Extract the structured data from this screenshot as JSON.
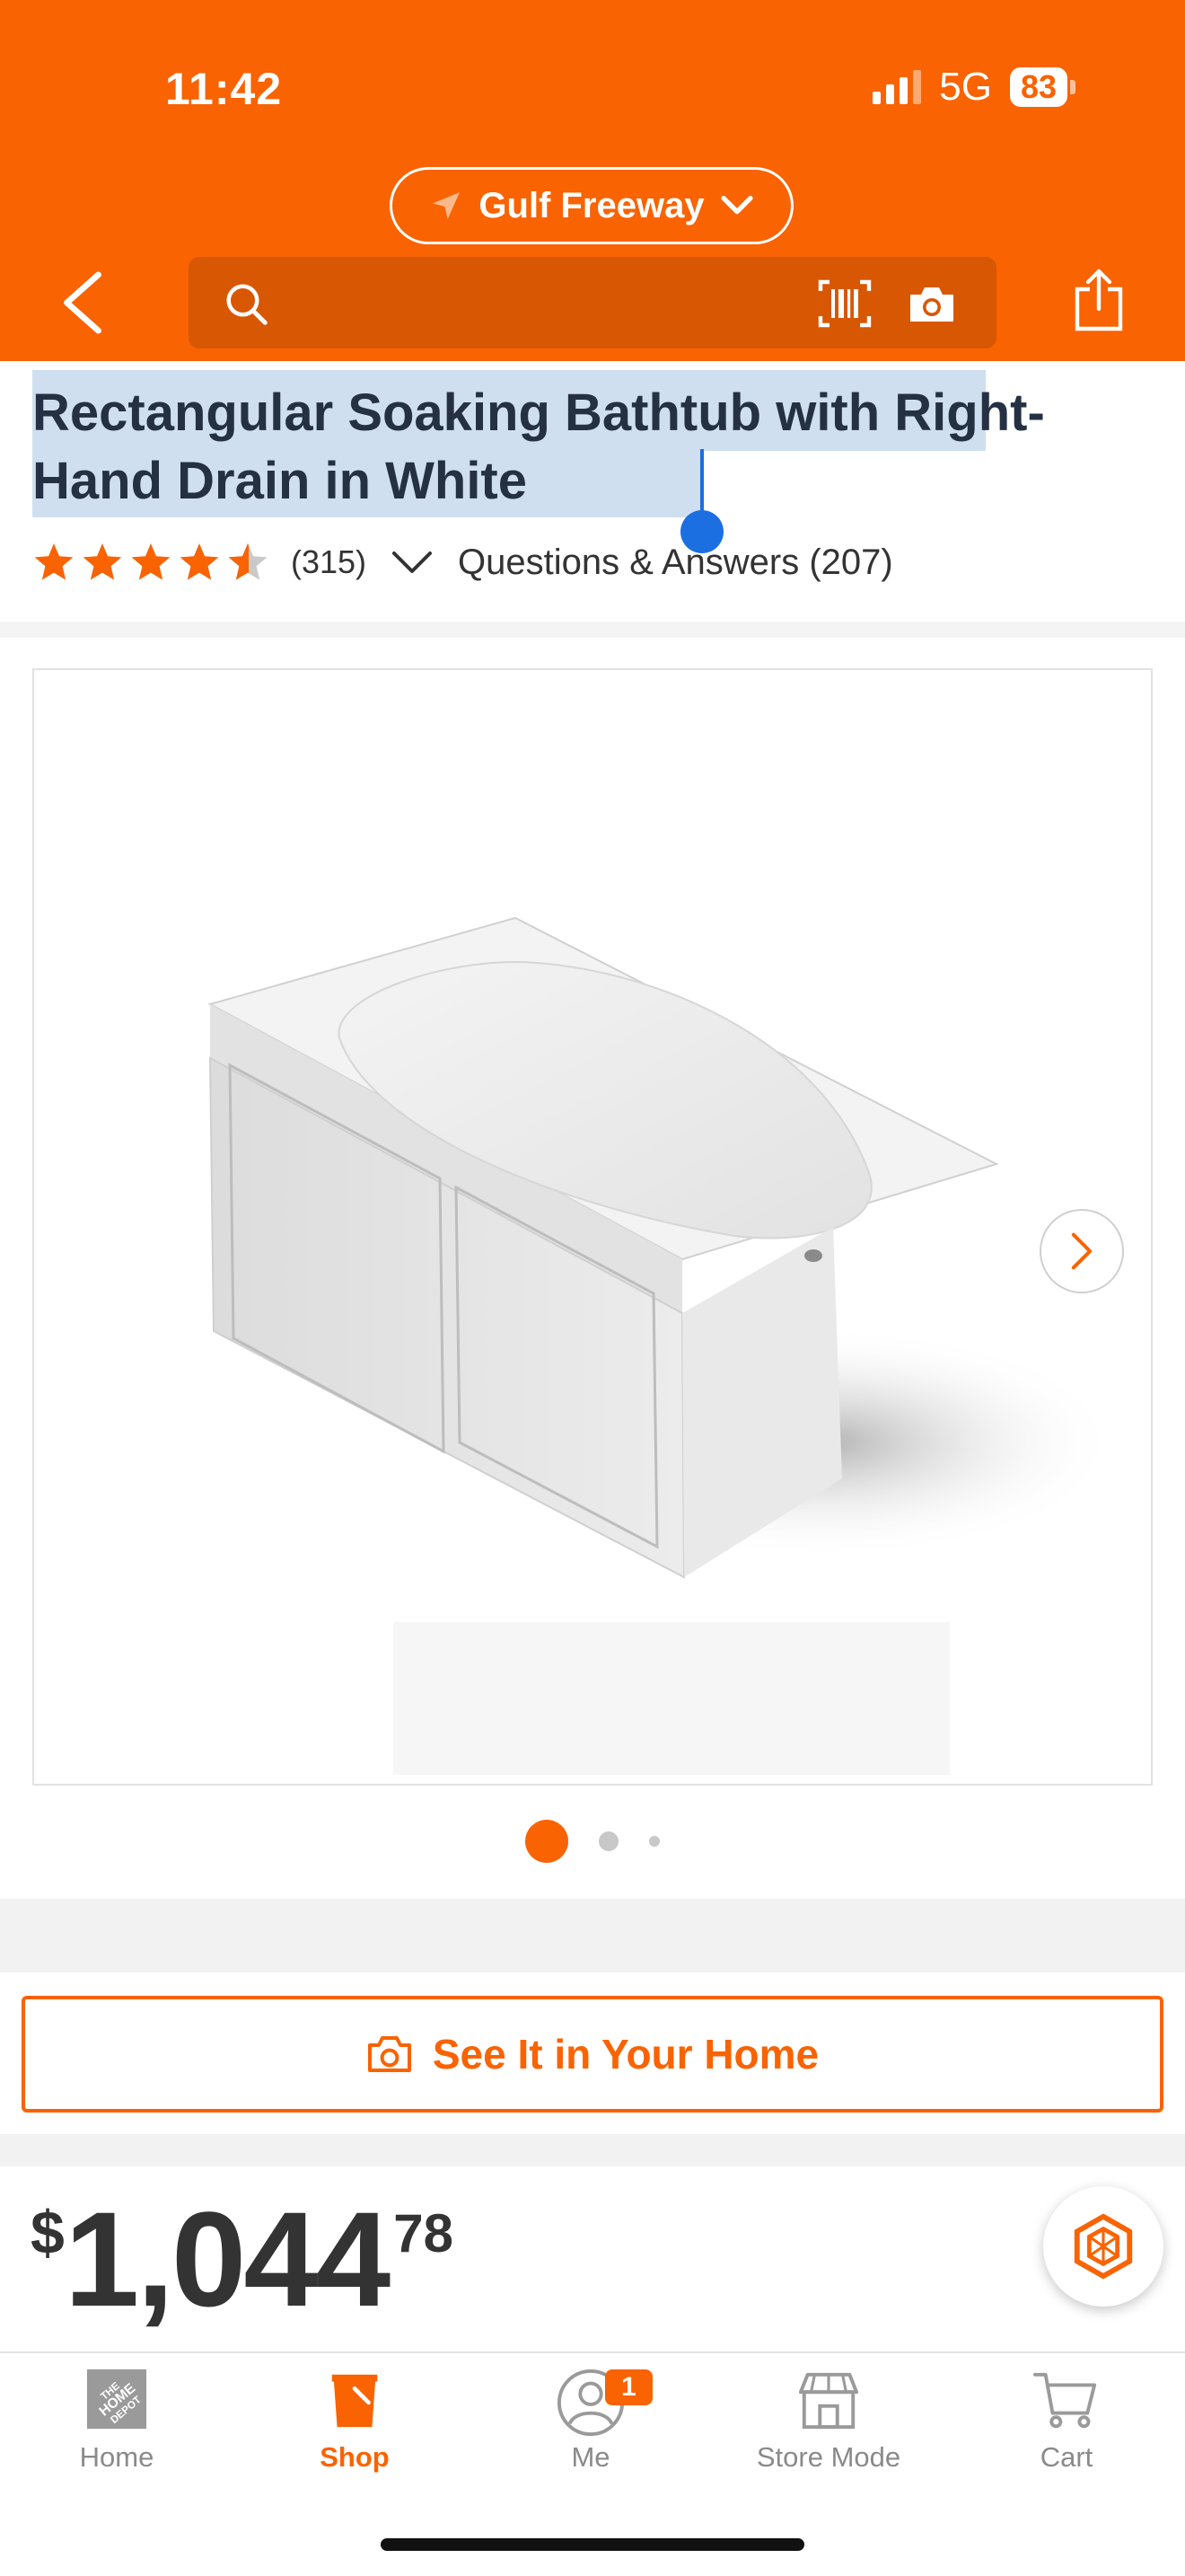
{
  "status_bar": {
    "time": "11:42",
    "network": "5G",
    "battery": "83"
  },
  "header": {
    "store_name": "Gulf Freeway",
    "search_placeholder": "",
    "brand_color": "#f96302"
  },
  "product": {
    "title": "Rectangular Soaking Bathtub with Right-Hand Drain in White",
    "rating": 4.5,
    "review_count": "(315)",
    "qa_label": "Questions & Answers (207)",
    "gallery": {
      "slide_count": 3,
      "active_index": 0
    },
    "see_it_label": "See It in Your Home",
    "price": {
      "symbol": "$",
      "dollars": "1,044",
      "cents": "78"
    }
  },
  "icons": {
    "back": "chevron-left-icon",
    "search": "search-icon",
    "barcode": "barcode-icon",
    "camera": "camera-icon",
    "share": "share-icon",
    "location": "location-arrow-icon",
    "chat": "chat-assistant-icon"
  },
  "tabbar": {
    "items": [
      {
        "label": "Home",
        "icon": "home-depot-logo-icon",
        "active": false
      },
      {
        "label": "Shop",
        "icon": "shop-bucket-icon",
        "active": true
      },
      {
        "label": "Me",
        "icon": "user-icon",
        "active": false,
        "badge": "1"
      },
      {
        "label": "Store Mode",
        "icon": "store-icon",
        "active": false
      },
      {
        "label": "Cart",
        "icon": "cart-icon",
        "active": false
      }
    ]
  }
}
